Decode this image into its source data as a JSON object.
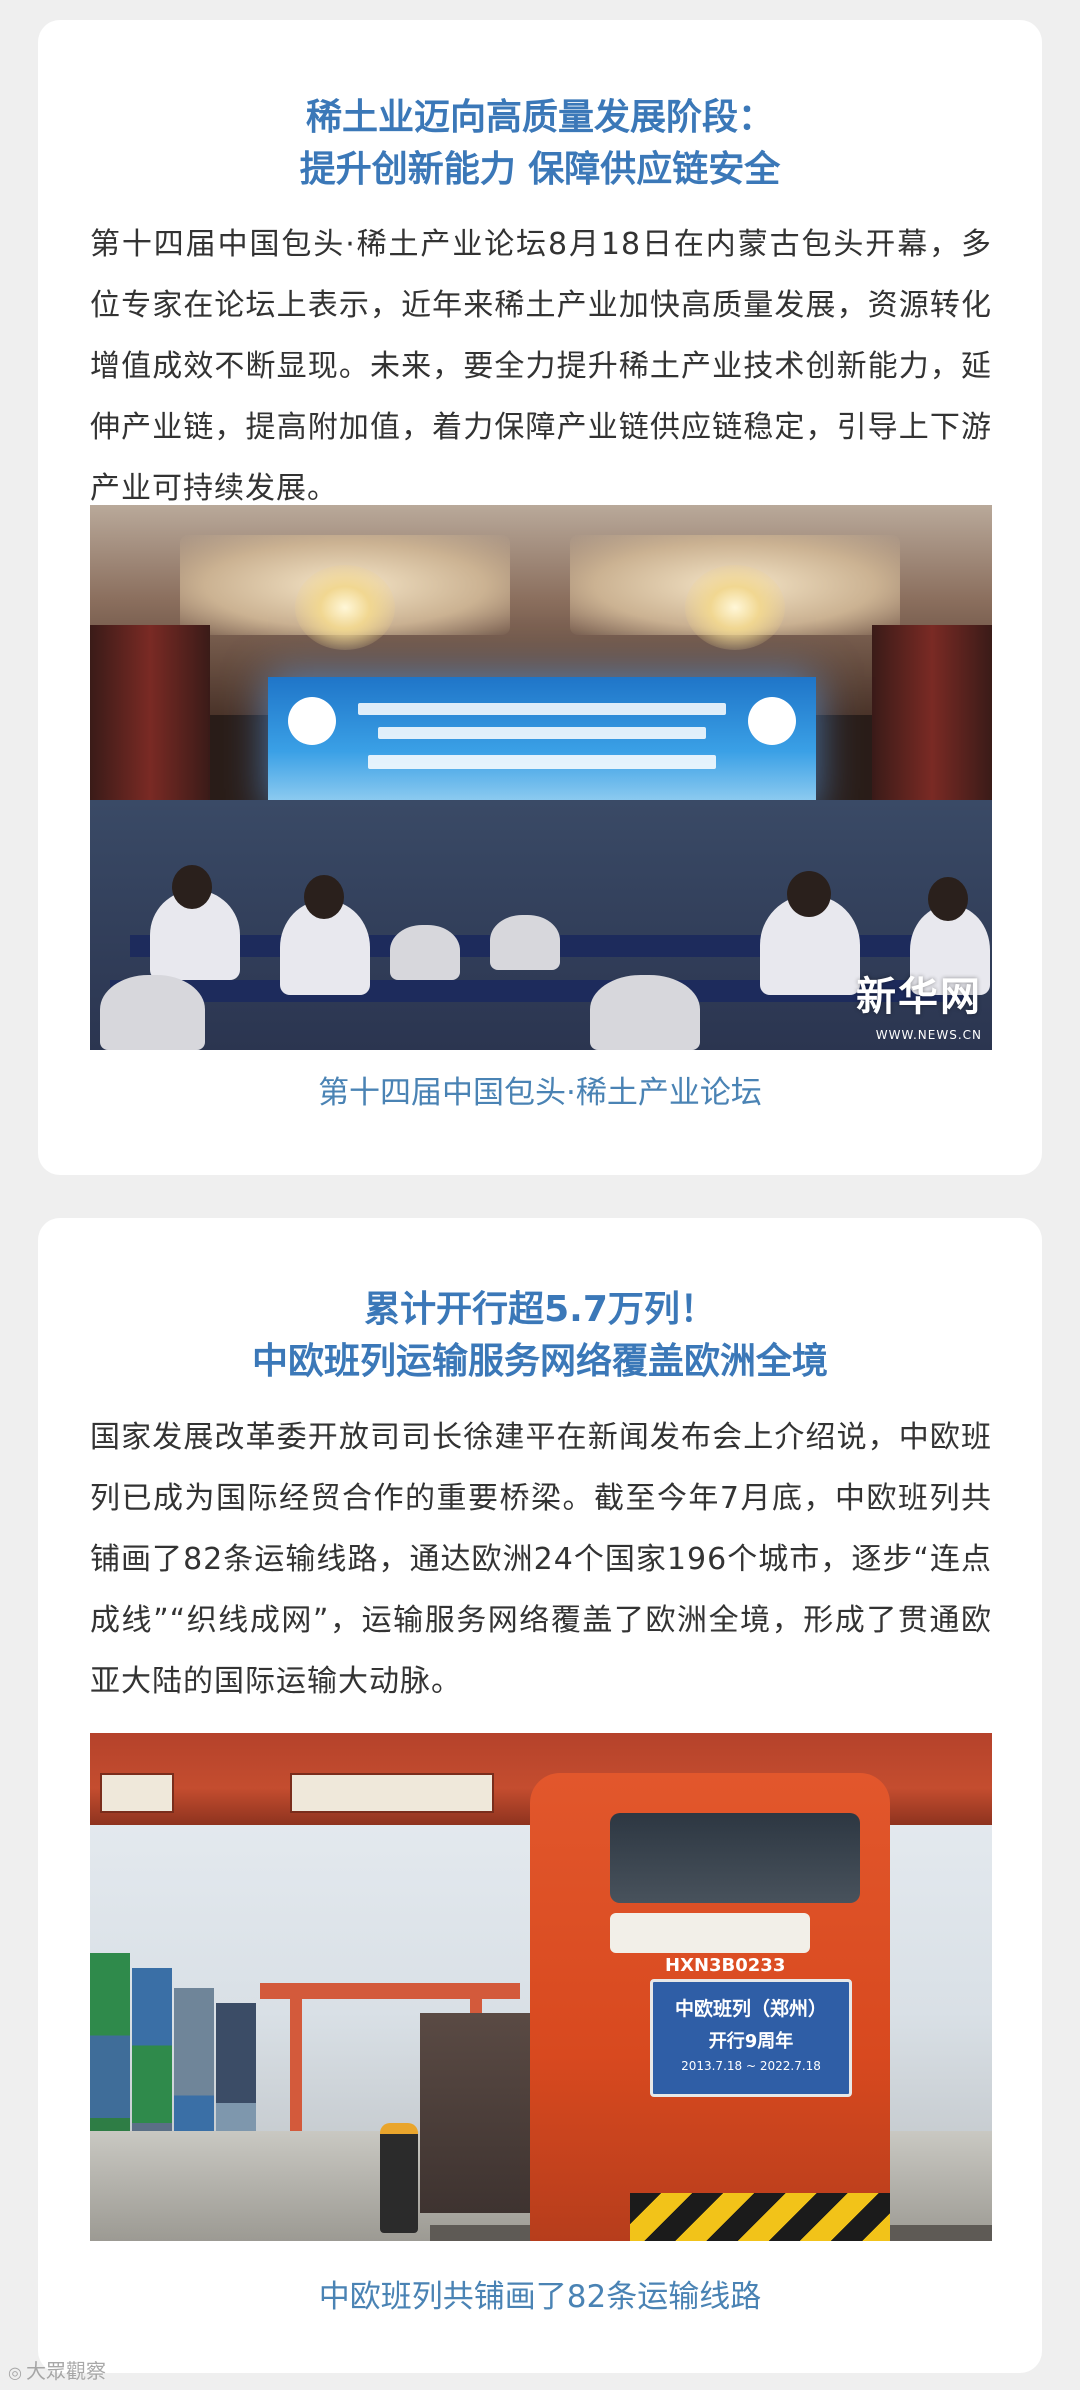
{
  "articles": [
    {
      "title_line1": "稀土业迈向高质量发展阶段：",
      "title_line2": "提升创新能力 保障供应链安全",
      "paragraph": "第十四届中国包头·稀土产业论坛8月18日在内蒙古包头开幕，多位专家在论坛上表示，近年来稀土产业加快高质量发展，资源转化增值成效不断显现。未来，要全力提升稀土产业技术创新能力，延伸产业链，提高附加值，着力保障产业链供应链稳定，引导上下游产业可持续发展。",
      "photo": {
        "watermark": "新华网",
        "watermark_url": "WWW.NEWS.CN"
      },
      "caption": "第十四届中国包头·稀土产业论坛"
    },
    {
      "title_line1": "累计开行超5.7万列！",
      "title_line2": "中欧班列运输服务网络覆盖欧洲全境",
      "paragraph": "国家发展改革委开放司司长徐建平在新闻发布会上介绍说，中欧班列已成为国际经贸合作的重要桥梁。截至今年7月底，中欧班列共铺画了82条运输线路，通达欧洲24个国家196个城市，逐步“连点成线”“织线成网”，运输服务网络覆盖了欧洲全境，形成了贯通欧亚大陆的国际运输大动脉。",
      "photo": {
        "loco_id": "HXN3B0233",
        "plate_line1": "中欧班列（郑州）",
        "plate_line2": "开行9周年",
        "plate_line3": "2013.7.18 ~ 2022.7.18"
      },
      "caption": "中欧班列共铺画了82条运输线路"
    }
  ],
  "watermark": {
    "text": "大眾觀察",
    "icon": "logo-icon"
  },
  "colors": {
    "title": "#3b78b8",
    "caption": "#4a83b4",
    "body_text": "#333333",
    "background": "#efefef",
    "card": "#ffffff"
  }
}
